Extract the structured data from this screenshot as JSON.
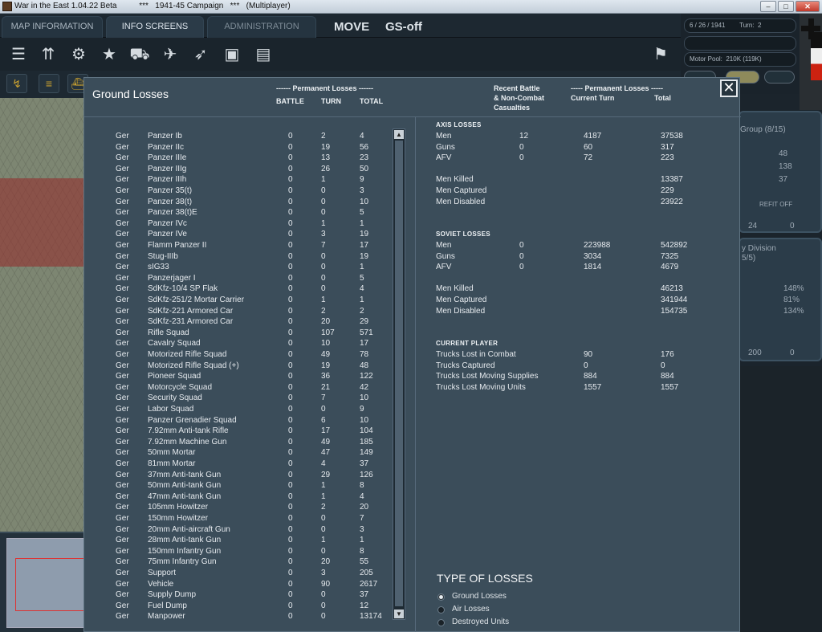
{
  "window": {
    "title": "War in the East 1.04.22 Beta          ***   1941-45 Campaign   ***   (Multiplayer)",
    "min": "–",
    "max": "□",
    "close": "✕"
  },
  "topbar": {
    "tabs": [
      "MAP INFORMATION",
      "INFO SCREENS",
      "ADMINISTRATION"
    ],
    "mode": "MOVE",
    "gs": "GS-off"
  },
  "info_panel": {
    "date": "6 / 26 / 1941        Turn:  2",
    "blank": "",
    "motor_pool": "Motor Pool:  210K (119K)"
  },
  "unit_panel_1": {
    "group": "Group (8/15)",
    "v1": "48",
    "v2": "138",
    "v3": "37",
    "refit": "REFIT OFF",
    "bottom_a": "24",
    "bottom_b": "0"
  },
  "unit_panel_2": {
    "division": "y Division",
    "frac": "5/5)",
    "p1": "148%",
    "p2": "81%",
    "p3": "134%",
    "bottom_a": "200",
    "bottom_b": "0"
  },
  "dialog": {
    "title": "Ground Losses",
    "left_header": {
      "perm": "------ Permanent Losses ------",
      "battle": "BATTLE",
      "turn": "TURN",
      "total": "TOTAL"
    },
    "right_header": {
      "recent": "Recent Battle\n& Non-Combat\nCasualties",
      "perm": "----- Permanent Losses -----",
      "current_turn": "Current Turn",
      "total": "Total"
    },
    "close": "✕"
  },
  "rows": [
    [
      "Ger",
      "Panzer Ib",
      "0",
      "2",
      "4"
    ],
    [
      "Ger",
      "Panzer IIc",
      "0",
      "19",
      "56"
    ],
    [
      "Ger",
      "Panzer IIIe",
      "0",
      "13",
      "23"
    ],
    [
      "Ger",
      "Panzer IIIg",
      "0",
      "26",
      "50"
    ],
    [
      "Ger",
      "Panzer IIIh",
      "0",
      "1",
      "9"
    ],
    [
      "Ger",
      "Panzer 35(t)",
      "0",
      "0",
      "3"
    ],
    [
      "Ger",
      "Panzer 38(t)",
      "0",
      "0",
      "10"
    ],
    [
      "Ger",
      "Panzer 38(t)E",
      "0",
      "0",
      "5"
    ],
    [
      "Ger",
      "Panzer IVc",
      "0",
      "1",
      "1"
    ],
    [
      "Ger",
      "Panzer IVe",
      "0",
      "3",
      "19"
    ],
    [
      "Ger",
      "Flamm Panzer II",
      "0",
      "7",
      "17"
    ],
    [
      "Ger",
      "Stug-IIIb",
      "0",
      "0",
      "19"
    ],
    [
      "Ger",
      "sIG33",
      "0",
      "0",
      "1"
    ],
    [
      "Ger",
      "Panzerjager I",
      "0",
      "0",
      "5"
    ],
    [
      "Ger",
      "SdKfz-10/4 SP Flak",
      "0",
      "0",
      "4"
    ],
    [
      "Ger",
      "SdKfz-251/2 Mortar Carrier",
      "0",
      "1",
      "1"
    ],
    [
      "Ger",
      "SdKfz-221 Armored Car",
      "0",
      "2",
      "2"
    ],
    [
      "Ger",
      "SdKfz-231 Armored Car",
      "0",
      "20",
      "29"
    ],
    [
      "Ger",
      "Rifle Squad",
      "0",
      "107",
      "571"
    ],
    [
      "Ger",
      "Cavalry Squad",
      "0",
      "10",
      "17"
    ],
    [
      "Ger",
      "Motorized Rifle Squad",
      "0",
      "49",
      "78"
    ],
    [
      "Ger",
      "Motorized Rifle Squad (+)",
      "0",
      "19",
      "48"
    ],
    [
      "Ger",
      "Pioneer Squad",
      "0",
      "36",
      "122"
    ],
    [
      "Ger",
      "Motorcycle Squad",
      "0",
      "21",
      "42"
    ],
    [
      "Ger",
      "Security Squad",
      "0",
      "7",
      "10"
    ],
    [
      "Ger",
      "Labor Squad",
      "0",
      "0",
      "9"
    ],
    [
      "Ger",
      "Panzer Grenadier Squad",
      "0",
      "6",
      "10"
    ],
    [
      "Ger",
      "7.92mm Anti-tank Rifle",
      "0",
      "17",
      "104"
    ],
    [
      "Ger",
      "7.92mm Machine Gun",
      "0",
      "49",
      "185"
    ],
    [
      "Ger",
      "50mm Mortar",
      "0",
      "47",
      "149"
    ],
    [
      "Ger",
      "81mm Mortar",
      "0",
      "4",
      "37"
    ],
    [
      "Ger",
      "37mm Anti-tank Gun",
      "0",
      "29",
      "126"
    ],
    [
      "Ger",
      "50mm Anti-tank Gun",
      "0",
      "1",
      "8"
    ],
    [
      "Ger",
      "47mm Anti-tank Gun",
      "0",
      "1",
      "4"
    ],
    [
      "Ger",
      "105mm Howitzer",
      "0",
      "2",
      "20"
    ],
    [
      "Ger",
      "150mm Howitzer",
      "0",
      "0",
      "7"
    ],
    [
      "Ger",
      "20mm Anti-aircraft Gun",
      "0",
      "0",
      "3"
    ],
    [
      "Ger",
      "28mm Anti-tank Gun",
      "0",
      "1",
      "1"
    ],
    [
      "Ger",
      "150mm Infantry Gun",
      "0",
      "0",
      "8"
    ],
    [
      "Ger",
      "75mm Infantry Gun",
      "0",
      "20",
      "55"
    ],
    [
      "Ger",
      "Support",
      "0",
      "3",
      "205"
    ],
    [
      "Ger",
      "Vehicle",
      "0",
      "90",
      "2617"
    ],
    [
      "Ger",
      "Supply Dump",
      "0",
      "0",
      "37"
    ],
    [
      "Ger",
      "Fuel Dump",
      "0",
      "0",
      "12"
    ],
    [
      "Ger",
      "Manpower",
      "0",
      "0",
      "13174"
    ]
  ],
  "axis": {
    "title": "AXIS LOSSES",
    "rows": [
      [
        "Men",
        "12",
        "4187",
        "37538"
      ],
      [
        "Guns",
        "0",
        "60",
        "317"
      ],
      [
        "AFV",
        "0",
        "72",
        "223"
      ]
    ],
    "extra": [
      [
        "Men Killed",
        "13387"
      ],
      [
        "Men Captured",
        "229"
      ],
      [
        "Men Disabled",
        "23922"
      ]
    ]
  },
  "soviet": {
    "title": "SOVIET LOSSES",
    "rows": [
      [
        "Men",
        "0",
        "223988",
        "542892"
      ],
      [
        "Guns",
        "0",
        "3034",
        "7325"
      ],
      [
        "AFV",
        "0",
        "1814",
        "4679"
      ]
    ],
    "extra": [
      [
        "Men Killed",
        "46213"
      ],
      [
        "Men Captured",
        "341944"
      ],
      [
        "Men Disabled",
        "154735"
      ]
    ]
  },
  "player": {
    "title": "CURRENT PLAYER",
    "rows": [
      [
        "Trucks Lost in Combat",
        "90",
        "176"
      ],
      [
        "Trucks Captured",
        "0",
        "0"
      ],
      [
        "Trucks Lost Moving Supplies",
        "884",
        "884"
      ],
      [
        "Trucks Lost Moving Units",
        "1557",
        "1557"
      ]
    ]
  },
  "types": {
    "title": "TYPE OF LOSSES",
    "options": [
      "Ground Losses",
      "Air Losses",
      "Destroyed Units"
    ],
    "selected": 0
  }
}
